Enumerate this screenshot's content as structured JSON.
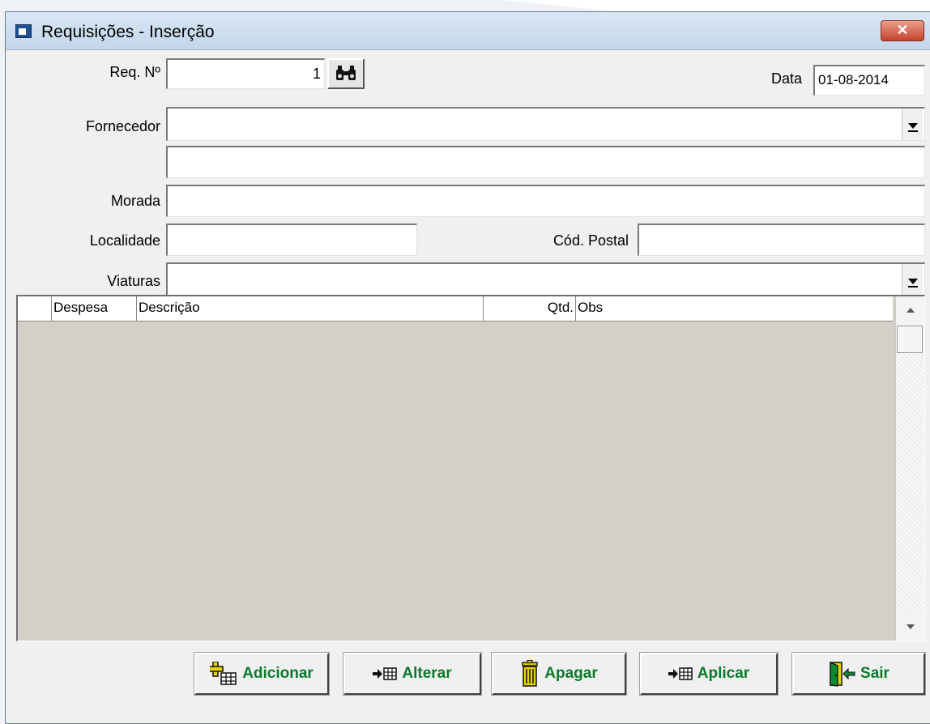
{
  "window": {
    "title": "Requisições - Inserção"
  },
  "form": {
    "req_label": "Req. Nº",
    "req_value": "1",
    "data_label": "Data",
    "data_value": "01-08-2014",
    "fornecedor_label": "Fornecedor",
    "fornecedor_value": "",
    "fornecedor_name_value": "",
    "morada_label": "Morada",
    "morada_value": "",
    "localidade_label": "Localidade",
    "localidade_value": "",
    "cod_postal_label": "Cód. Postal",
    "cod_postal_value": "",
    "viaturas_label": "Viaturas",
    "viaturas_value": ""
  },
  "grid": {
    "columns": [
      "Despesa",
      "Descrição",
      "Qtd.",
      "Obs"
    ],
    "rows": []
  },
  "buttons": {
    "add": "Adicionar",
    "edit": "Alterar",
    "delete": "Apagar",
    "apply": "Aplicar",
    "exit": "Sair"
  },
  "icons": {
    "find": "binoculars-icon",
    "add": "add-record-icon",
    "edit": "arrow-table-icon",
    "delete": "trash-icon",
    "apply": "arrow-table-icon",
    "exit": "exit-door-icon"
  },
  "colors": {
    "button_text": "#0a7a2a",
    "grid_background": "#d4d0c8",
    "title_bar": "#c3d6ea",
    "close_button": "#c7402b"
  }
}
